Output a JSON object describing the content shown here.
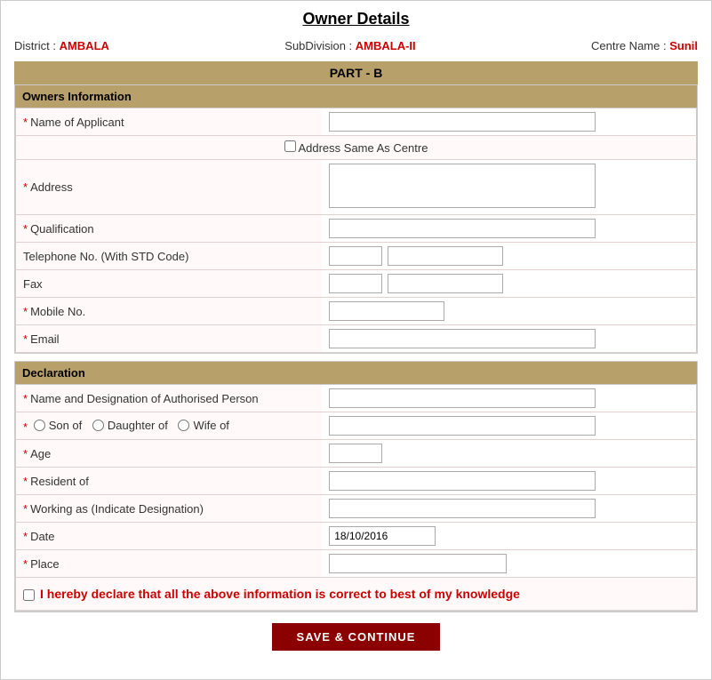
{
  "page": {
    "title": "Owner Details",
    "meta": {
      "district_label": "District :",
      "district_value": "AMBALA",
      "subdivision_label": "SubDivision :",
      "subdivision_value": "AMBALA-II",
      "centre_label": "Centre Name :",
      "centre_value": "Sunil"
    },
    "part_label": "PART - B",
    "owners_section": {
      "header": "Owners Information",
      "fields": {
        "name_label": "Name of Applicant",
        "address_same_label": "Address Same As Centre",
        "address_label": "Address",
        "qualification_label": "Qualification",
        "telephone_label": "Telephone No. (With STD Code)",
        "fax_label": "Fax",
        "mobile_label": "Mobile No.",
        "email_label": "Email"
      }
    },
    "declaration_section": {
      "header": "Declaration",
      "fields": {
        "auth_person_label": "Name and Designation of Authorised Person",
        "son_label": "Son of",
        "daughter_label": "Daughter of",
        "wife_label": "Wife of",
        "age_label": "Age",
        "resident_label": "Resident of",
        "working_label": "Working as (Indicate Designation)",
        "date_label": "Date",
        "date_value": "18/10/2016",
        "place_label": "Place"
      },
      "declaration_text": "I hereby declare that all the above information is correct to best of my knowledge"
    },
    "save_button_label": "SAVE & CONTINUE"
  }
}
